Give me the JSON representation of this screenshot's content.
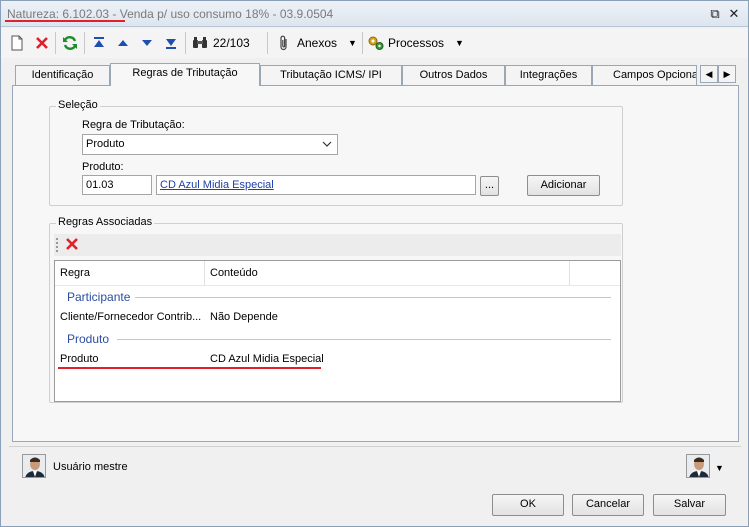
{
  "window": {
    "title_prefix": "Natureza: ",
    "title_code": "6.102.03",
    "title_rest": " - Venda p/ uso consumo 18% - 03.9.0504",
    "restore_glyph": "⧉",
    "close_glyph": "✕"
  },
  "toolbar": {
    "record_counter": "22/103",
    "anexos_label": "Anexos",
    "processos_label": "Processos",
    "dropdown_arrow": "▼"
  },
  "tabs": [
    {
      "label": "Identificação"
    },
    {
      "label": "Regras de Tributação"
    },
    {
      "label": "Tributação ICMS/ IPI"
    },
    {
      "label": "Outros Dados"
    },
    {
      "label": "Integrações"
    },
    {
      "label": "Campos Opcionais"
    }
  ],
  "tab_scroll": {
    "left": "◀",
    "right": "▶"
  },
  "selecao": {
    "group_title": "Seleção",
    "regra_label": "Regra de Tributação:",
    "regra_value": "Produto",
    "produto_label": "Produto:",
    "produto_code": "01.03",
    "produto_desc": "CD Azul Midia Especial",
    "browse_label": "...",
    "add_button": "Adicionar"
  },
  "regras": {
    "group_title": "Regras Associadas",
    "columns": [
      "Regra",
      "Conteúdo"
    ],
    "groups": [
      {
        "name": "Participante",
        "rows": [
          {
            "regra": "Cliente/Fornecedor Contrib...",
            "conteudo": "Não Depende"
          }
        ]
      },
      {
        "name": "Produto",
        "rows": [
          {
            "regra": "Produto",
            "conteudo": "CD Azul Midia Especial"
          }
        ]
      }
    ]
  },
  "footer": {
    "user_name": "Usuário mestre",
    "ok": "OK",
    "cancel": "Cancelar",
    "save": "Salvar"
  },
  "icons": {
    "new": "new-document-icon",
    "delete": "delete-icon",
    "refresh": "refresh-icon",
    "first": "first-record-icon",
    "prev": "previous-record-icon",
    "next": "next-record-icon",
    "last": "last-record-icon",
    "search": "binoculars-icon",
    "attach": "paperclip-icon",
    "process": "gears-icon"
  },
  "colors": {
    "accent_red": "#e0202a",
    "link_blue": "#1d3fa8",
    "group_blue": "#2a4ea0",
    "nav_blue": "#1f4fae",
    "refresh_green": "#1f8c2a"
  }
}
